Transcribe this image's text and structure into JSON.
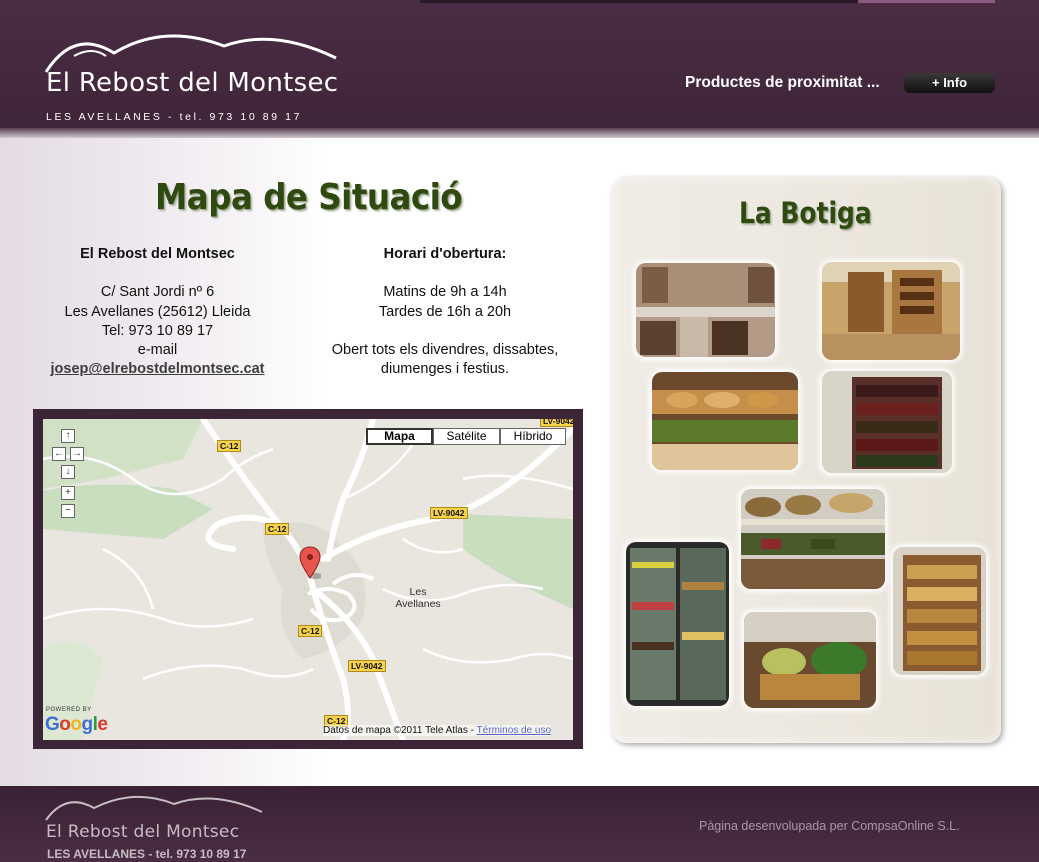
{
  "header": {
    "logo_name": "El Rebost del Montsec",
    "logo_sub": "LES AVELLANES  -  tel. 973 10 89 17",
    "tagline": "Productes de proximitat ...",
    "info_button": "+ Info"
  },
  "map_section": {
    "title": "Mapa de Situació",
    "address": {
      "heading": "El Rebost del Montsec",
      "line1": "C/ Sant Jordi nº 6",
      "line2": "Les Avellanes (25612) Lleida",
      "line3": "Tel: 973 10 89 17",
      "email_label": "e-mail",
      "email": "josep@elrebostdelmontsec.cat"
    },
    "hours": {
      "heading": "Horari d'obertura:",
      "line1": "Matins de 9h a 14h",
      "line2": "Tardes de 16h a 20h",
      "line3": "Obert tots els divendres, dissabtes,",
      "line4": "diumenges i festius."
    },
    "map": {
      "type_buttons": [
        "Mapa",
        "Satélite",
        "Híbrido"
      ],
      "active_type": "Mapa",
      "controls": [
        "↑",
        "←",
        "→",
        "↓",
        "+",
        "−"
      ],
      "roads": [
        "C-12",
        "C-12",
        "LV-9042",
        "C-12",
        "LV-9042",
        "C-12",
        "LV-9042"
      ],
      "town": "Les Avellanes",
      "powered_by": "POWERED BY",
      "google": "Google",
      "attribution": "Datos de mapa ©2011 Tele Atlas - ",
      "terms": "Términos de uso"
    }
  },
  "shop": {
    "title": "La Botiga"
  },
  "footer": {
    "logo_name": "El Rebost del Montsec",
    "logo_sub": "LES AVELLANES  -  tel.  973 10 89 17",
    "credit": "Pàgina desenvolupada per CompsaOnline S.L."
  },
  "colors": {
    "header_bg": "#4a2c45",
    "title_green": "#2e4a10",
    "footer_bg": "#3a2135"
  }
}
